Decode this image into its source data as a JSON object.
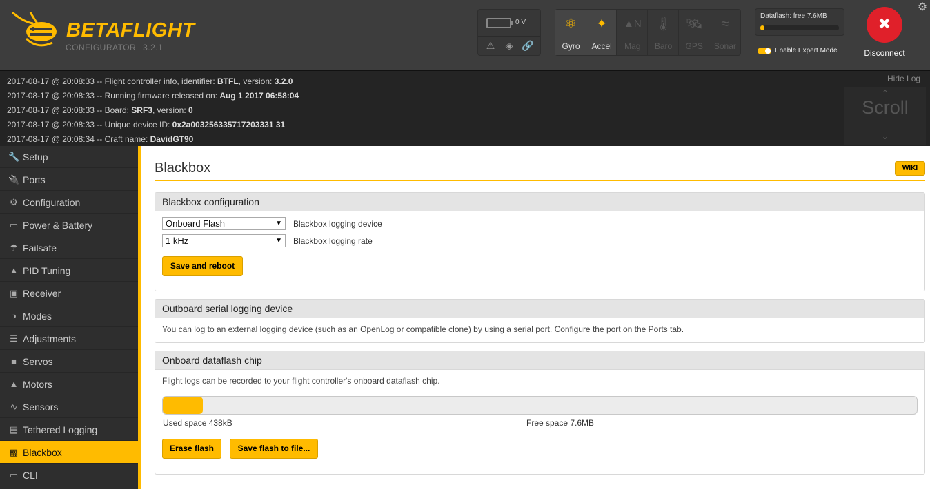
{
  "header": {
    "logo_title": "BETAFLIGHT",
    "logo_sub": "CONFIGURATOR",
    "version": "3.2.1",
    "battery_voltage": "0 V",
    "sensors": [
      {
        "label": "Gyro",
        "icon": "gyro-icon",
        "active": true
      },
      {
        "label": "Accel",
        "icon": "accel-icon",
        "active": true
      },
      {
        "label": "Mag",
        "icon": "mag-icon",
        "active": false
      },
      {
        "label": "Baro",
        "icon": "baro-icon",
        "active": false
      },
      {
        "label": "GPS",
        "icon": "gps-icon",
        "active": false
      },
      {
        "label": "Sonar",
        "icon": "sonar-icon",
        "active": false
      }
    ],
    "dataflash_label": "Dataflash: free 7.6MB",
    "dataflash_used_fraction": 0.05,
    "expert_mode_label": "Enable Expert Mode",
    "expert_mode_on": true,
    "disconnect_label": "Disconnect"
  },
  "log": {
    "hide_label": "Hide Log",
    "scroll_label": "Scroll",
    "lines": [
      {
        "prefix": "2017-08-17 @ 20:08:33 -- Flight controller info, identifier: ",
        "b1": "BTFL",
        "mid": ", version: ",
        "b2": "3.2.0"
      },
      {
        "prefix": "2017-08-17 @ 20:08:33 -- Running firmware released on: ",
        "b1": "Aug 1 2017 06:58:04",
        "mid": "",
        "b2": ""
      },
      {
        "prefix": "2017-08-17 @ 20:08:33 -- Board: ",
        "b1": "SRF3",
        "mid": ", version: ",
        "b2": "0"
      },
      {
        "prefix": "2017-08-17 @ 20:08:33 -- Unique device ID: ",
        "b1": "0x2a003256335717203331 31",
        "mid": "",
        "b2": ""
      },
      {
        "prefix": "2017-08-17 @ 20:08:34 -- Craft name: ",
        "b1": "DavidGT90",
        "mid": "",
        "b2": ""
      }
    ]
  },
  "sidebar": {
    "items": [
      {
        "label": "Setup",
        "icon": "wrench-icon"
      },
      {
        "label": "Ports",
        "icon": "plug-icon"
      },
      {
        "label": "Configuration",
        "icon": "gear-icon"
      },
      {
        "label": "Power & Battery",
        "icon": "battery-icon"
      },
      {
        "label": "Failsafe",
        "icon": "parachute-icon"
      },
      {
        "label": "PID Tuning",
        "icon": "pid-icon"
      },
      {
        "label": "Receiver",
        "icon": "receiver-icon"
      },
      {
        "label": "Modes",
        "icon": "modes-icon"
      },
      {
        "label": "Adjustments",
        "icon": "sliders-icon"
      },
      {
        "label": "Servos",
        "icon": "servo-icon"
      },
      {
        "label": "Motors",
        "icon": "motor-icon"
      },
      {
        "label": "Sensors",
        "icon": "sensor-wave-icon"
      },
      {
        "label": "Tethered Logging",
        "icon": "log-icon"
      },
      {
        "label": "Blackbox",
        "icon": "blackbox-icon",
        "active": true
      },
      {
        "label": "CLI",
        "icon": "terminal-icon"
      }
    ]
  },
  "main": {
    "title": "Blackbox",
    "wiki_label": "WIKI",
    "config_box": {
      "title": "Blackbox configuration",
      "device_value": "Onboard Flash",
      "device_label": "Blackbox logging device",
      "rate_value": "1 kHz",
      "rate_label": "Blackbox logging rate",
      "save_label": "Save and reboot"
    },
    "serial_box": {
      "title": "Outboard serial logging device",
      "description": "You can log to an external logging device (such as an OpenLog or compatible clone) by using a serial port. Configure the port on the Ports tab."
    },
    "dataflash_box": {
      "title": "Onboard dataflash chip",
      "description": "Flight logs can be recorded to your flight controller's onboard dataflash chip.",
      "used_fraction": 0.053,
      "used_label": "Used space 438kB",
      "free_label": "Free space 7.6MB",
      "erase_label": "Erase flash",
      "save_label": "Save flash to file..."
    }
  }
}
